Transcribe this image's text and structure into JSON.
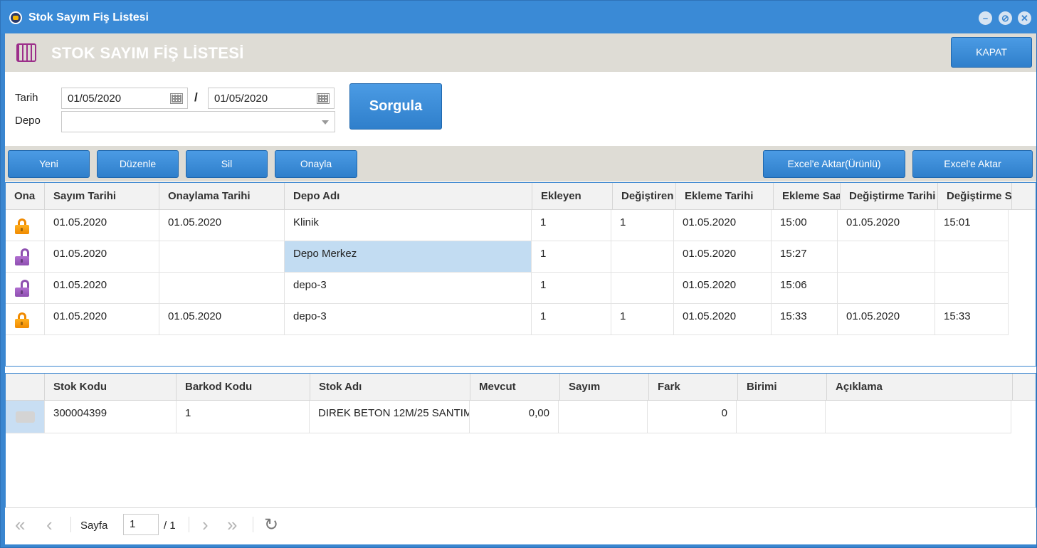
{
  "window": {
    "title": "Stok Sayım Fiş Listesi"
  },
  "header": {
    "title": "STOK SAYIM FİŞ LİSTESİ",
    "close_label": "KAPAT"
  },
  "filters": {
    "date_label": "Tarih",
    "date_from": "01/05/2020",
    "separator": "/",
    "date_to": "01/05/2020",
    "depot_label": "Depo",
    "depot_value": "",
    "query_label": "Sorgula"
  },
  "toolbar": {
    "new_label": "Yeni",
    "edit_label": "Düzenle",
    "delete_label": "Sil",
    "approve_label": "Onayla",
    "excel_products_label": "Excel'e Aktar(Ürünlü)",
    "excel_label": "Excel'e Aktar"
  },
  "main_grid": {
    "columns": [
      "Ona",
      "Sayım Tarihi",
      "Onaylama Tarihi",
      "Depo Adı",
      "Ekleyen",
      "Değiştiren",
      "Ekleme Tarihi",
      "Ekleme Saati",
      "Değiştirme Tarihi",
      "Değiştirme Saati"
    ],
    "rows": [
      {
        "locked": true,
        "c1": "01.05.2020",
        "c2": "01.05.2020",
        "c3": "Klinik",
        "c4": "1",
        "c5": "1",
        "c6": "01.05.2020",
        "c7": "15:00",
        "c8": "01.05.2020",
        "c9": "15:01"
      },
      {
        "locked": false,
        "c1": "01.05.2020",
        "c2": "",
        "c3": "Depo Merkez",
        "c4": "1",
        "c5": "",
        "c6": "01.05.2020",
        "c7": "15:27",
        "c8": "",
        "c9": ""
      },
      {
        "locked": false,
        "c1": "01.05.2020",
        "c2": "",
        "c3": "depo-3",
        "c4": "1",
        "c5": "",
        "c6": "01.05.2020",
        "c7": "15:06",
        "c8": "",
        "c9": ""
      },
      {
        "locked": true,
        "c1": "01.05.2020",
        "c2": "01.05.2020",
        "c3": "depo-3",
        "c4": "1",
        "c5": "1",
        "c6": "01.05.2020",
        "c7": "15:33",
        "c8": "01.05.2020",
        "c9": "15:33"
      }
    ],
    "colors": {
      "locked": "#f08a00",
      "unlocked": "#8e4fb0",
      "selected": "#c2dcf2"
    }
  },
  "detail_grid": {
    "columns": [
      "",
      "Stok Kodu",
      "Barkod Kodu",
      "Stok Adı",
      "Mevcut",
      "Sayım",
      "Fark",
      "Birimi",
      "Açıklama"
    ],
    "rows": [
      {
        "c1": "300004399",
        "c2": "1",
        "c3": "DIREK BETON 12M/25 SANTIM",
        "c4": "0,00",
        "c5": "",
        "c6": "0",
        "c7": "",
        "c8": ""
      }
    ]
  },
  "pager": {
    "page_label": "Sayfa",
    "page_value": "1",
    "total": "/ 1"
  }
}
